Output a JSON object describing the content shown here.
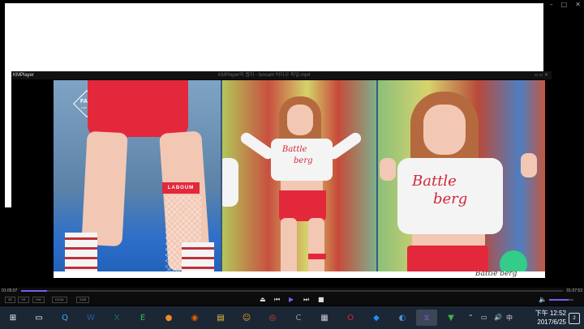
{
  "player": {
    "app_name": "KMPlayer",
    "file_title": "KMPlayer의 캡처 - fancam 비디오 파일.mp4",
    "watermark_top": "FA",
    "watermark_bottom": "CAM",
    "shirt_text_1": "Battle",
    "shirt_text_2": "berg",
    "legband_text": "LABOUM",
    "caption_text": "Battle berg"
  },
  "window_controls": [
    "–",
    "□",
    "✕"
  ],
  "playback": {
    "time_elapsed": "01:05:07",
    "time_total": "01:07:53",
    "progress_fraction": 0.048,
    "volume_fraction": 0.8,
    "tags": [
      "3D",
      "VR",
      "HW",
      "DXVA",
      "SUB"
    ]
  },
  "taskbar": {
    "clock_time": "下午 12:52",
    "clock_date": "2017/6/25",
    "ime": "中",
    "notification_count": "2",
    "apps": [
      {
        "name": "start",
        "glyph": "⊞",
        "color": "#ffffff"
      },
      {
        "name": "task-view",
        "glyph": "▭",
        "color": "#ffffff"
      },
      {
        "name": "browser-q",
        "glyph": "Q",
        "color": "#3fa9f5"
      },
      {
        "name": "word",
        "glyph": "W",
        "color": "#2b5797"
      },
      {
        "name": "excel",
        "glyph": "X",
        "color": "#1e7145"
      },
      {
        "name": "evernote",
        "glyph": "E",
        "color": "#2dbe60"
      },
      {
        "name": "orange-app",
        "glyph": "●",
        "color": "#f28c28"
      },
      {
        "name": "firefox",
        "glyph": "◉",
        "color": "#e66000"
      },
      {
        "name": "file-explorer",
        "glyph": "▤",
        "color": "#f0c040"
      },
      {
        "name": "emoji-app",
        "glyph": "☺",
        "color": "#f5a623"
      },
      {
        "name": "chrome",
        "glyph": "◎",
        "color": "#db4437"
      },
      {
        "name": "ccleaner",
        "glyph": "C",
        "color": "#999999"
      },
      {
        "name": "calculator",
        "glyph": "▦",
        "color": "#cccccc"
      },
      {
        "name": "opera",
        "glyph": "O",
        "color": "#e0232e"
      },
      {
        "name": "blue-app",
        "glyph": "◆",
        "color": "#1e90ff"
      },
      {
        "name": "globe",
        "glyph": "◐",
        "color": "#4a90d9"
      },
      {
        "name": "visual-studio",
        "glyph": "⧖",
        "color": "#8a5cd6"
      },
      {
        "name": "security",
        "glyph": "▼",
        "color": "#3cb043"
      }
    ]
  },
  "colors": {
    "accent": "#7b5cf0",
    "taskbar_bg": "#1b2735"
  }
}
